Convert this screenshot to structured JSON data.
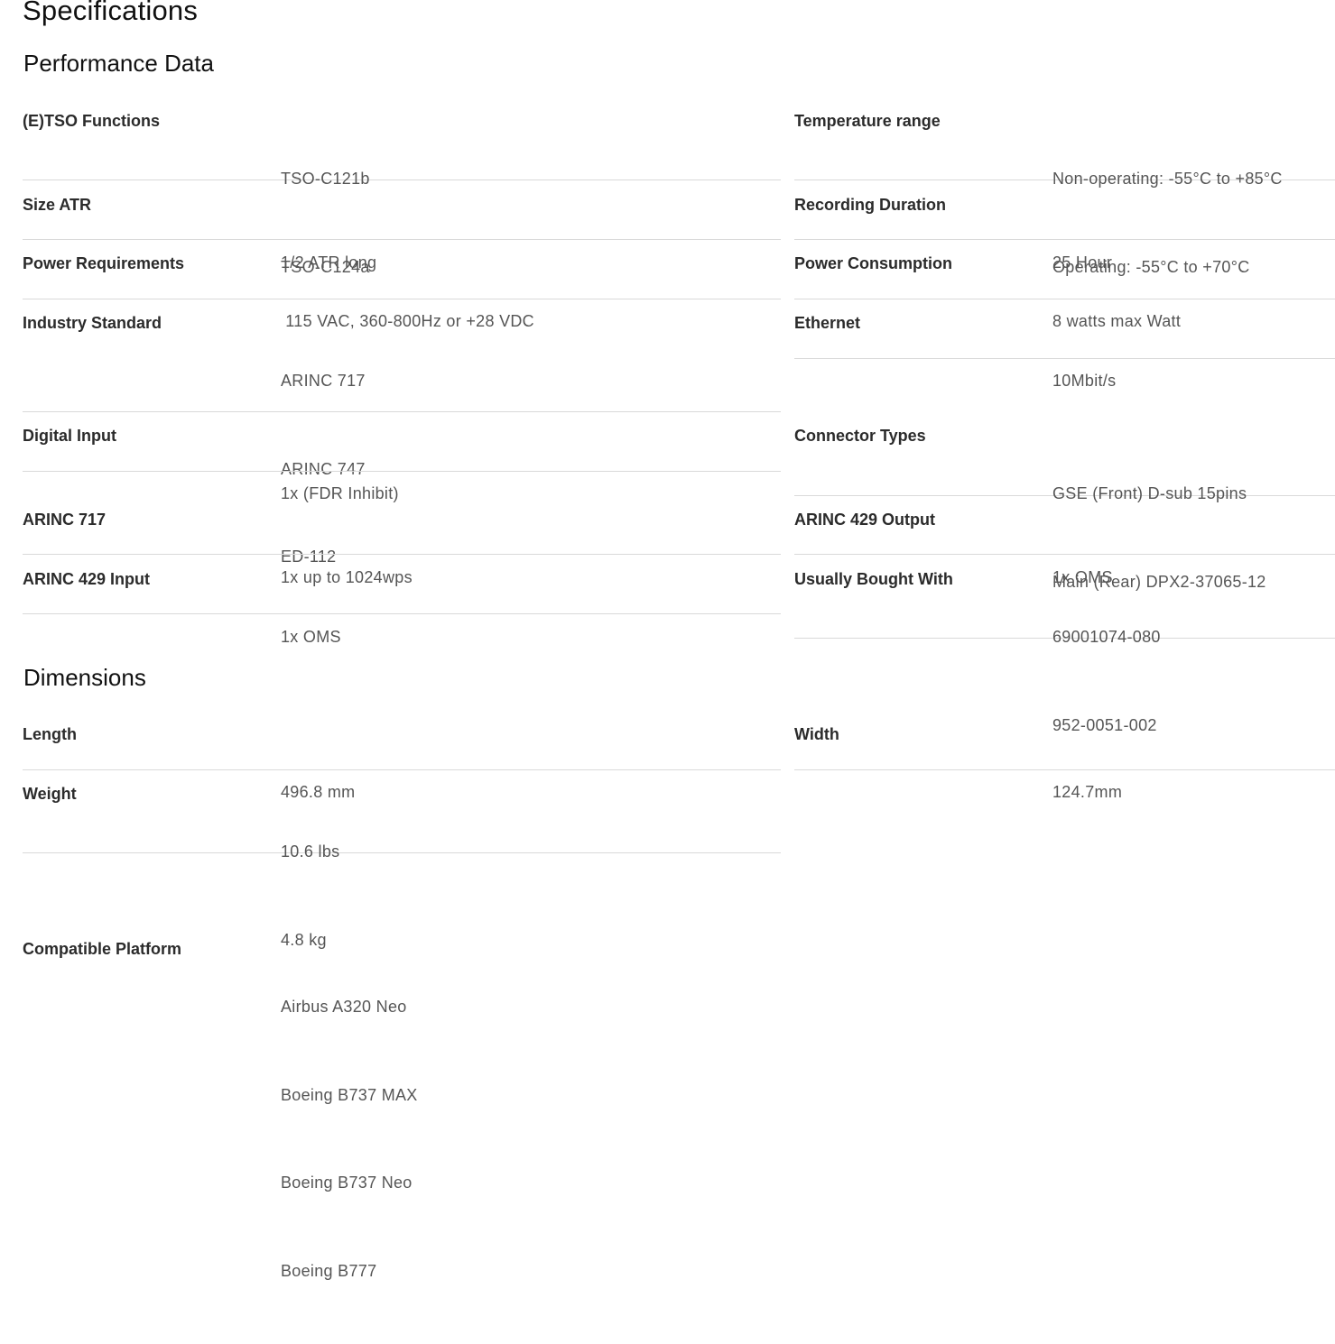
{
  "page": {
    "title": "Specifications"
  },
  "performance": {
    "title": "Performance Data",
    "left": [
      {
        "label": "(E)TSO Functions",
        "values": [
          "TSO-C121b",
          "TSO-C124a"
        ]
      },
      {
        "label": "Size ATR",
        "values": [
          "1/2 ATR long"
        ]
      },
      {
        "label": "Power Requirements",
        "values": [
          " 115 VAC, 360-800Hz or +28 VDC"
        ]
      },
      {
        "label": "Industry Standard",
        "values": [
          "ARINC 717",
          "ARINC 747",
          "ED-112"
        ]
      },
      {
        "label": "Digital Input",
        "values": [
          "1x (FDR Inhibit)"
        ]
      },
      {
        "label": "ARINC 717",
        "values": [
          "1x up to 1024wps"
        ]
      },
      {
        "label": "ARINC 429 Input",
        "values": [
          "1x OMS"
        ]
      }
    ],
    "right": [
      {
        "label": "Temperature range",
        "values": [
          "Non-operating: -55°C to +85°C",
          "Operating: -55°C to +70°C"
        ]
      },
      {
        "label": "Recording Duration",
        "values": [
          "25 Hour"
        ]
      },
      {
        "label": "Power Consumption",
        "values": [
          "8 watts max Watt"
        ]
      },
      {
        "label": "Ethernet",
        "values": [
          "10Mbit/s"
        ]
      },
      {
        "label": "Connector Types",
        "values": [
          "GSE (Front) D-sub 15pins",
          "Main (Rear) DPX2-37065-12"
        ]
      },
      {
        "label": "ARINC 429 Output",
        "values": [
          "1x OMS"
        ]
      },
      {
        "label": "Usually Bought With",
        "values": [
          "69001074-080",
          "952-0051-002"
        ]
      }
    ]
  },
  "dimensions": {
    "title": "Dimensions",
    "left": [
      {
        "label": "Length",
        "values": [
          "496.8 mm"
        ]
      },
      {
        "label": "Weight",
        "values": [
          "10.6 lbs",
          "4.8 kg"
        ]
      }
    ],
    "right": [
      {
        "label": "Width",
        "values": [
          "124.7mm"
        ]
      }
    ]
  },
  "compatibility": {
    "label": "Compatible Platform",
    "values": [
      "Airbus A320 Neo",
      "Boeing B737 MAX",
      "Boeing B737 Neo",
      "Boeing B777"
    ]
  }
}
